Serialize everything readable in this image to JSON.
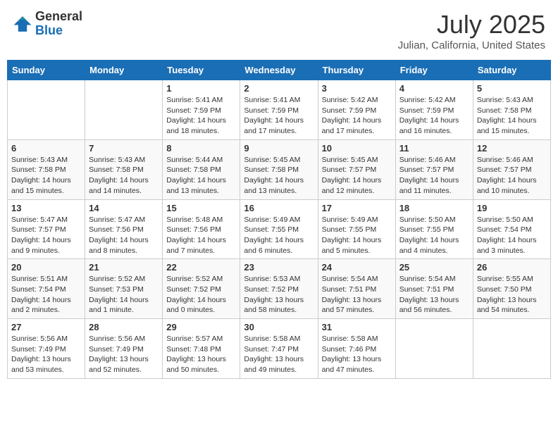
{
  "header": {
    "logo": {
      "general": "General",
      "blue": "Blue"
    },
    "title": "July 2025",
    "subtitle": "Julian, California, United States"
  },
  "weekdays": [
    "Sunday",
    "Monday",
    "Tuesday",
    "Wednesday",
    "Thursday",
    "Friday",
    "Saturday"
  ],
  "weeks": [
    [
      {
        "day": "",
        "info": ""
      },
      {
        "day": "",
        "info": ""
      },
      {
        "day": "1",
        "info": "Sunrise: 5:41 AM\nSunset: 7:59 PM\nDaylight: 14 hours\nand 18 minutes."
      },
      {
        "day": "2",
        "info": "Sunrise: 5:41 AM\nSunset: 7:59 PM\nDaylight: 14 hours\nand 17 minutes."
      },
      {
        "day": "3",
        "info": "Sunrise: 5:42 AM\nSunset: 7:59 PM\nDaylight: 14 hours\nand 17 minutes."
      },
      {
        "day": "4",
        "info": "Sunrise: 5:42 AM\nSunset: 7:59 PM\nDaylight: 14 hours\nand 16 minutes."
      },
      {
        "day": "5",
        "info": "Sunrise: 5:43 AM\nSunset: 7:58 PM\nDaylight: 14 hours\nand 15 minutes."
      }
    ],
    [
      {
        "day": "6",
        "info": "Sunrise: 5:43 AM\nSunset: 7:58 PM\nDaylight: 14 hours\nand 15 minutes."
      },
      {
        "day": "7",
        "info": "Sunrise: 5:43 AM\nSunset: 7:58 PM\nDaylight: 14 hours\nand 14 minutes."
      },
      {
        "day": "8",
        "info": "Sunrise: 5:44 AM\nSunset: 7:58 PM\nDaylight: 14 hours\nand 13 minutes."
      },
      {
        "day": "9",
        "info": "Sunrise: 5:45 AM\nSunset: 7:58 PM\nDaylight: 14 hours\nand 13 minutes."
      },
      {
        "day": "10",
        "info": "Sunrise: 5:45 AM\nSunset: 7:57 PM\nDaylight: 14 hours\nand 12 minutes."
      },
      {
        "day": "11",
        "info": "Sunrise: 5:46 AM\nSunset: 7:57 PM\nDaylight: 14 hours\nand 11 minutes."
      },
      {
        "day": "12",
        "info": "Sunrise: 5:46 AM\nSunset: 7:57 PM\nDaylight: 14 hours\nand 10 minutes."
      }
    ],
    [
      {
        "day": "13",
        "info": "Sunrise: 5:47 AM\nSunset: 7:57 PM\nDaylight: 14 hours\nand 9 minutes."
      },
      {
        "day": "14",
        "info": "Sunrise: 5:47 AM\nSunset: 7:56 PM\nDaylight: 14 hours\nand 8 minutes."
      },
      {
        "day": "15",
        "info": "Sunrise: 5:48 AM\nSunset: 7:56 PM\nDaylight: 14 hours\nand 7 minutes."
      },
      {
        "day": "16",
        "info": "Sunrise: 5:49 AM\nSunset: 7:55 PM\nDaylight: 14 hours\nand 6 minutes."
      },
      {
        "day": "17",
        "info": "Sunrise: 5:49 AM\nSunset: 7:55 PM\nDaylight: 14 hours\nand 5 minutes."
      },
      {
        "day": "18",
        "info": "Sunrise: 5:50 AM\nSunset: 7:55 PM\nDaylight: 14 hours\nand 4 minutes."
      },
      {
        "day": "19",
        "info": "Sunrise: 5:50 AM\nSunset: 7:54 PM\nDaylight: 14 hours\nand 3 minutes."
      }
    ],
    [
      {
        "day": "20",
        "info": "Sunrise: 5:51 AM\nSunset: 7:54 PM\nDaylight: 14 hours\nand 2 minutes."
      },
      {
        "day": "21",
        "info": "Sunrise: 5:52 AM\nSunset: 7:53 PM\nDaylight: 14 hours\nand 1 minute."
      },
      {
        "day": "22",
        "info": "Sunrise: 5:52 AM\nSunset: 7:52 PM\nDaylight: 14 hours\nand 0 minutes."
      },
      {
        "day": "23",
        "info": "Sunrise: 5:53 AM\nSunset: 7:52 PM\nDaylight: 13 hours\nand 58 minutes."
      },
      {
        "day": "24",
        "info": "Sunrise: 5:54 AM\nSunset: 7:51 PM\nDaylight: 13 hours\nand 57 minutes."
      },
      {
        "day": "25",
        "info": "Sunrise: 5:54 AM\nSunset: 7:51 PM\nDaylight: 13 hours\nand 56 minutes."
      },
      {
        "day": "26",
        "info": "Sunrise: 5:55 AM\nSunset: 7:50 PM\nDaylight: 13 hours\nand 54 minutes."
      }
    ],
    [
      {
        "day": "27",
        "info": "Sunrise: 5:56 AM\nSunset: 7:49 PM\nDaylight: 13 hours\nand 53 minutes."
      },
      {
        "day": "28",
        "info": "Sunrise: 5:56 AM\nSunset: 7:49 PM\nDaylight: 13 hours\nand 52 minutes."
      },
      {
        "day": "29",
        "info": "Sunrise: 5:57 AM\nSunset: 7:48 PM\nDaylight: 13 hours\nand 50 minutes."
      },
      {
        "day": "30",
        "info": "Sunrise: 5:58 AM\nSunset: 7:47 PM\nDaylight: 13 hours\nand 49 minutes."
      },
      {
        "day": "31",
        "info": "Sunrise: 5:58 AM\nSunset: 7:46 PM\nDaylight: 13 hours\nand 47 minutes."
      },
      {
        "day": "",
        "info": ""
      },
      {
        "day": "",
        "info": ""
      }
    ]
  ]
}
